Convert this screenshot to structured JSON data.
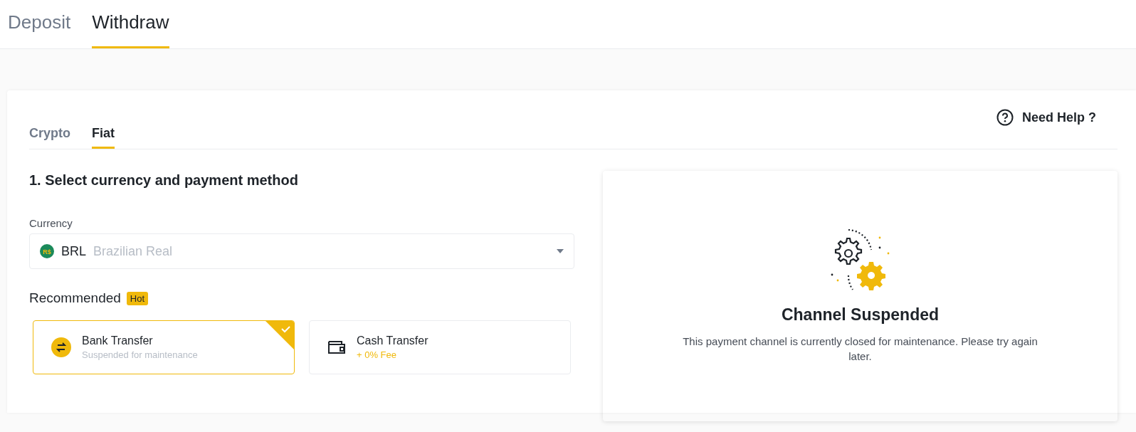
{
  "top_tabs": [
    {
      "label": "Deposit",
      "selected": false
    },
    {
      "label": "Withdraw",
      "selected": true
    }
  ],
  "sub_tabs": [
    {
      "label": "Crypto",
      "selected": false
    },
    {
      "label": "Fiat",
      "selected": true
    }
  ],
  "help_link": "Need Help ?",
  "step_title": "1. Select currency and payment method",
  "currency": {
    "label": "Currency",
    "symbol": "R$",
    "code": "BRL",
    "name": "Brazilian Real"
  },
  "recommended": {
    "label": "Recommended",
    "badge": "Hot"
  },
  "methods": [
    {
      "name": "Bank Transfer",
      "detail": "Suspended for maintenance",
      "kind": "status",
      "selected": true
    },
    {
      "name": "Cash Transfer",
      "detail": "+ 0% Fee",
      "kind": "fee",
      "selected": false
    }
  ],
  "notice": {
    "title": "Channel Suspended",
    "message": "This payment channel is currently closed for maintenance. Please try again later."
  }
}
